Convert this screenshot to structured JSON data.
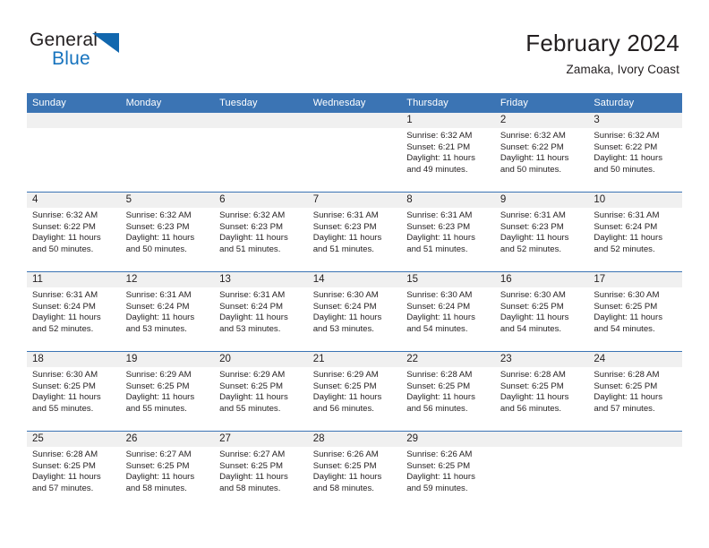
{
  "logo": {
    "word_one": "General",
    "word_two": "Blue",
    "triangle_color": "#1167ae",
    "text_color": "#231f20",
    "blue_text_color": "#1673be"
  },
  "header": {
    "title": "February 2024",
    "subtitle": "Zamaka, Ivory Coast",
    "header_bg": "#3b74b4",
    "header_text": "#ffffff",
    "daynum_band_bg": "#f0f0f0"
  },
  "weekdays": [
    "Sunday",
    "Monday",
    "Tuesday",
    "Wednesday",
    "Thursday",
    "Friday",
    "Saturday"
  ],
  "weeks": [
    [
      {
        "day": "",
        "sunrise": "",
        "sunset": "",
        "daylight_1": "",
        "daylight_2": ""
      },
      {
        "day": "",
        "sunrise": "",
        "sunset": "",
        "daylight_1": "",
        "daylight_2": ""
      },
      {
        "day": "",
        "sunrise": "",
        "sunset": "",
        "daylight_1": "",
        "daylight_2": ""
      },
      {
        "day": "",
        "sunrise": "",
        "sunset": "",
        "daylight_1": "",
        "daylight_2": ""
      },
      {
        "day": "1",
        "sunrise": "Sunrise: 6:32 AM",
        "sunset": "Sunset: 6:21 PM",
        "daylight_1": "Daylight: 11 hours",
        "daylight_2": "and 49 minutes."
      },
      {
        "day": "2",
        "sunrise": "Sunrise: 6:32 AM",
        "sunset": "Sunset: 6:22 PM",
        "daylight_1": "Daylight: 11 hours",
        "daylight_2": "and 50 minutes."
      },
      {
        "day": "3",
        "sunrise": "Sunrise: 6:32 AM",
        "sunset": "Sunset: 6:22 PM",
        "daylight_1": "Daylight: 11 hours",
        "daylight_2": "and 50 minutes."
      }
    ],
    [
      {
        "day": "4",
        "sunrise": "Sunrise: 6:32 AM",
        "sunset": "Sunset: 6:22 PM",
        "daylight_1": "Daylight: 11 hours",
        "daylight_2": "and 50 minutes."
      },
      {
        "day": "5",
        "sunrise": "Sunrise: 6:32 AM",
        "sunset": "Sunset: 6:23 PM",
        "daylight_1": "Daylight: 11 hours",
        "daylight_2": "and 50 minutes."
      },
      {
        "day": "6",
        "sunrise": "Sunrise: 6:32 AM",
        "sunset": "Sunset: 6:23 PM",
        "daylight_1": "Daylight: 11 hours",
        "daylight_2": "and 51 minutes."
      },
      {
        "day": "7",
        "sunrise": "Sunrise: 6:31 AM",
        "sunset": "Sunset: 6:23 PM",
        "daylight_1": "Daylight: 11 hours",
        "daylight_2": "and 51 minutes."
      },
      {
        "day": "8",
        "sunrise": "Sunrise: 6:31 AM",
        "sunset": "Sunset: 6:23 PM",
        "daylight_1": "Daylight: 11 hours",
        "daylight_2": "and 51 minutes."
      },
      {
        "day": "9",
        "sunrise": "Sunrise: 6:31 AM",
        "sunset": "Sunset: 6:23 PM",
        "daylight_1": "Daylight: 11 hours",
        "daylight_2": "and 52 minutes."
      },
      {
        "day": "10",
        "sunrise": "Sunrise: 6:31 AM",
        "sunset": "Sunset: 6:24 PM",
        "daylight_1": "Daylight: 11 hours",
        "daylight_2": "and 52 minutes."
      }
    ],
    [
      {
        "day": "11",
        "sunrise": "Sunrise: 6:31 AM",
        "sunset": "Sunset: 6:24 PM",
        "daylight_1": "Daylight: 11 hours",
        "daylight_2": "and 52 minutes."
      },
      {
        "day": "12",
        "sunrise": "Sunrise: 6:31 AM",
        "sunset": "Sunset: 6:24 PM",
        "daylight_1": "Daylight: 11 hours",
        "daylight_2": "and 53 minutes."
      },
      {
        "day": "13",
        "sunrise": "Sunrise: 6:31 AM",
        "sunset": "Sunset: 6:24 PM",
        "daylight_1": "Daylight: 11 hours",
        "daylight_2": "and 53 minutes."
      },
      {
        "day": "14",
        "sunrise": "Sunrise: 6:30 AM",
        "sunset": "Sunset: 6:24 PM",
        "daylight_1": "Daylight: 11 hours",
        "daylight_2": "and 53 minutes."
      },
      {
        "day": "15",
        "sunrise": "Sunrise: 6:30 AM",
        "sunset": "Sunset: 6:24 PM",
        "daylight_1": "Daylight: 11 hours",
        "daylight_2": "and 54 minutes."
      },
      {
        "day": "16",
        "sunrise": "Sunrise: 6:30 AM",
        "sunset": "Sunset: 6:25 PM",
        "daylight_1": "Daylight: 11 hours",
        "daylight_2": "and 54 minutes."
      },
      {
        "day": "17",
        "sunrise": "Sunrise: 6:30 AM",
        "sunset": "Sunset: 6:25 PM",
        "daylight_1": "Daylight: 11 hours",
        "daylight_2": "and 54 minutes."
      }
    ],
    [
      {
        "day": "18",
        "sunrise": "Sunrise: 6:30 AM",
        "sunset": "Sunset: 6:25 PM",
        "daylight_1": "Daylight: 11 hours",
        "daylight_2": "and 55 minutes."
      },
      {
        "day": "19",
        "sunrise": "Sunrise: 6:29 AM",
        "sunset": "Sunset: 6:25 PM",
        "daylight_1": "Daylight: 11 hours",
        "daylight_2": "and 55 minutes."
      },
      {
        "day": "20",
        "sunrise": "Sunrise: 6:29 AM",
        "sunset": "Sunset: 6:25 PM",
        "daylight_1": "Daylight: 11 hours",
        "daylight_2": "and 55 minutes."
      },
      {
        "day": "21",
        "sunrise": "Sunrise: 6:29 AM",
        "sunset": "Sunset: 6:25 PM",
        "daylight_1": "Daylight: 11 hours",
        "daylight_2": "and 56 minutes."
      },
      {
        "day": "22",
        "sunrise": "Sunrise: 6:28 AM",
        "sunset": "Sunset: 6:25 PM",
        "daylight_1": "Daylight: 11 hours",
        "daylight_2": "and 56 minutes."
      },
      {
        "day": "23",
        "sunrise": "Sunrise: 6:28 AM",
        "sunset": "Sunset: 6:25 PM",
        "daylight_1": "Daylight: 11 hours",
        "daylight_2": "and 56 minutes."
      },
      {
        "day": "24",
        "sunrise": "Sunrise: 6:28 AM",
        "sunset": "Sunset: 6:25 PM",
        "daylight_1": "Daylight: 11 hours",
        "daylight_2": "and 57 minutes."
      }
    ],
    [
      {
        "day": "25",
        "sunrise": "Sunrise: 6:28 AM",
        "sunset": "Sunset: 6:25 PM",
        "daylight_1": "Daylight: 11 hours",
        "daylight_2": "and 57 minutes."
      },
      {
        "day": "26",
        "sunrise": "Sunrise: 6:27 AM",
        "sunset": "Sunset: 6:25 PM",
        "daylight_1": "Daylight: 11 hours",
        "daylight_2": "and 58 minutes."
      },
      {
        "day": "27",
        "sunrise": "Sunrise: 6:27 AM",
        "sunset": "Sunset: 6:25 PM",
        "daylight_1": "Daylight: 11 hours",
        "daylight_2": "and 58 minutes."
      },
      {
        "day": "28",
        "sunrise": "Sunrise: 6:26 AM",
        "sunset": "Sunset: 6:25 PM",
        "daylight_1": "Daylight: 11 hours",
        "daylight_2": "and 58 minutes."
      },
      {
        "day": "29",
        "sunrise": "Sunrise: 6:26 AM",
        "sunset": "Sunset: 6:25 PM",
        "daylight_1": "Daylight: 11 hours",
        "daylight_2": "and 59 minutes."
      },
      {
        "day": "",
        "sunrise": "",
        "sunset": "",
        "daylight_1": "",
        "daylight_2": ""
      },
      {
        "day": "",
        "sunrise": "",
        "sunset": "",
        "daylight_1": "",
        "daylight_2": ""
      }
    ]
  ]
}
